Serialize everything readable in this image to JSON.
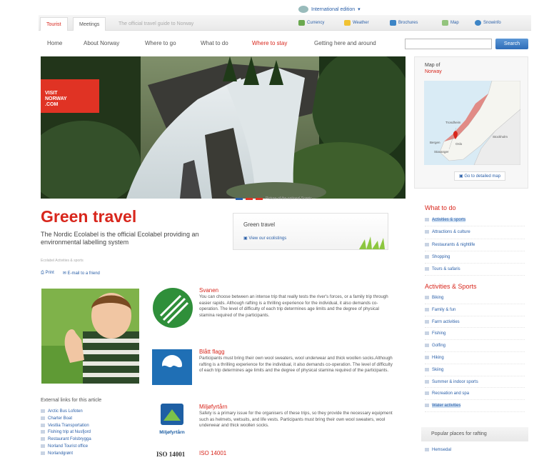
{
  "utility": {
    "edition": "International edition"
  },
  "topbar": {
    "tabs": [
      "Tourist",
      "Meetings"
    ],
    "tagline": "The official travel guide to Norway",
    "tools": [
      {
        "label": "Currency",
        "icon": "currency-icon",
        "color": "#6aa84f"
      },
      {
        "label": "Weather",
        "icon": "weather-icon",
        "color": "#f1c232"
      },
      {
        "label": "Brochures",
        "icon": "brochures-icon",
        "color": "#3d85c6"
      },
      {
        "label": "Map",
        "icon": "map-icon",
        "color": "#93c47d"
      },
      {
        "label": "Snowinfo",
        "icon": "snow-icon",
        "color": "#3d85c6"
      }
    ]
  },
  "nav": {
    "items": [
      "Home",
      "About Norway",
      "Where to go",
      "What to do",
      "Where to stay",
      "Getting here and around"
    ],
    "active": "Where to stay",
    "search_button": "Search",
    "search_placeholder": ""
  },
  "hero": {
    "logo": [
      "VISIT",
      "NORWAY",
      ".COM"
    ],
    "caption": "Picture of the national Scenic"
  },
  "map": {
    "label": "Map of",
    "country": "Norway",
    "cities": [
      "Trondheim",
      "Bergen",
      "Oslo",
      "Stavanger",
      "Stockholm"
    ],
    "link": "Go to detailed map"
  },
  "article": {
    "title": "Green travel",
    "intro": "The Nordic Ecolabel is the official Ecolabel providing an environmental labelling system",
    "crumb": "Ecolabel  Activities & sports",
    "print": "Print",
    "email": "E-mail to a friend",
    "box_title": "Green travel",
    "box_link": "View our ecolistings",
    "labels": [
      {
        "title": "Svanen",
        "text": "You can choose between an intense trip that really tests the river's forces, or a family trip through easier rapids. Although rafting is a thrilling experience for the individual, it also demands co-operation. The level of difficulty of each trip determines age limits and the degree of physical stamina required of the participants."
      },
      {
        "title": "Blått flagg",
        "text": "Participants must bring their own wool sweaters, wool underwear and thick woollen socks.Although rafting is a thrilling experience for the individual, it also demands co-operation. The level of difficulty of each trip determines age limits and the degree of physical stamina required of the participants."
      },
      {
        "title": "Miljøfyrtårn",
        "text": "Safety is a primary issue for the organisers of these trips, so they provide the necessary equipment such as helmets, wetsuits, and life vests. Participants must bring their own wool sweaters, wool underwear and thick woollen socks."
      },
      {
        "title": "ISO 14001",
        "text": ""
      }
    ],
    "miljo_logo_text": "Miljøfyrtårn",
    "iso_logo_text": "ISO 14001"
  },
  "external": {
    "heading": "External links for this article",
    "links": [
      "Arctic Bus Lofoten",
      "Charter Boat",
      "Vestlia Transportation",
      "Fishing trip at Nusfjord",
      "Restaurant Folsbrygga",
      "Norland Tourist office",
      "Norlandgrønt"
    ]
  },
  "sidebar": {
    "what_to_do_heading": "What to do",
    "what_to_do": [
      "Activities & sports",
      "Attractions & culture",
      "Restaurants & nightlife",
      "Shopping",
      "Tours & safaris"
    ],
    "what_to_do_highlight": "Activities & sports",
    "activities_heading": "Activities & Sports",
    "activities": [
      "Biking",
      "Family & fun",
      "Farm activities",
      "Fishing",
      "Golfing",
      "Hiking",
      "Skiing",
      "Summer & indoor sports",
      "Recreation and spa",
      "Water activities"
    ],
    "activities_highlight": "Water activities",
    "popular_heading": "Popular places for rafting",
    "popular": [
      "Hemsedal"
    ]
  },
  "colors": {
    "accent": "#d8261c",
    "link": "#2a5fa8"
  }
}
